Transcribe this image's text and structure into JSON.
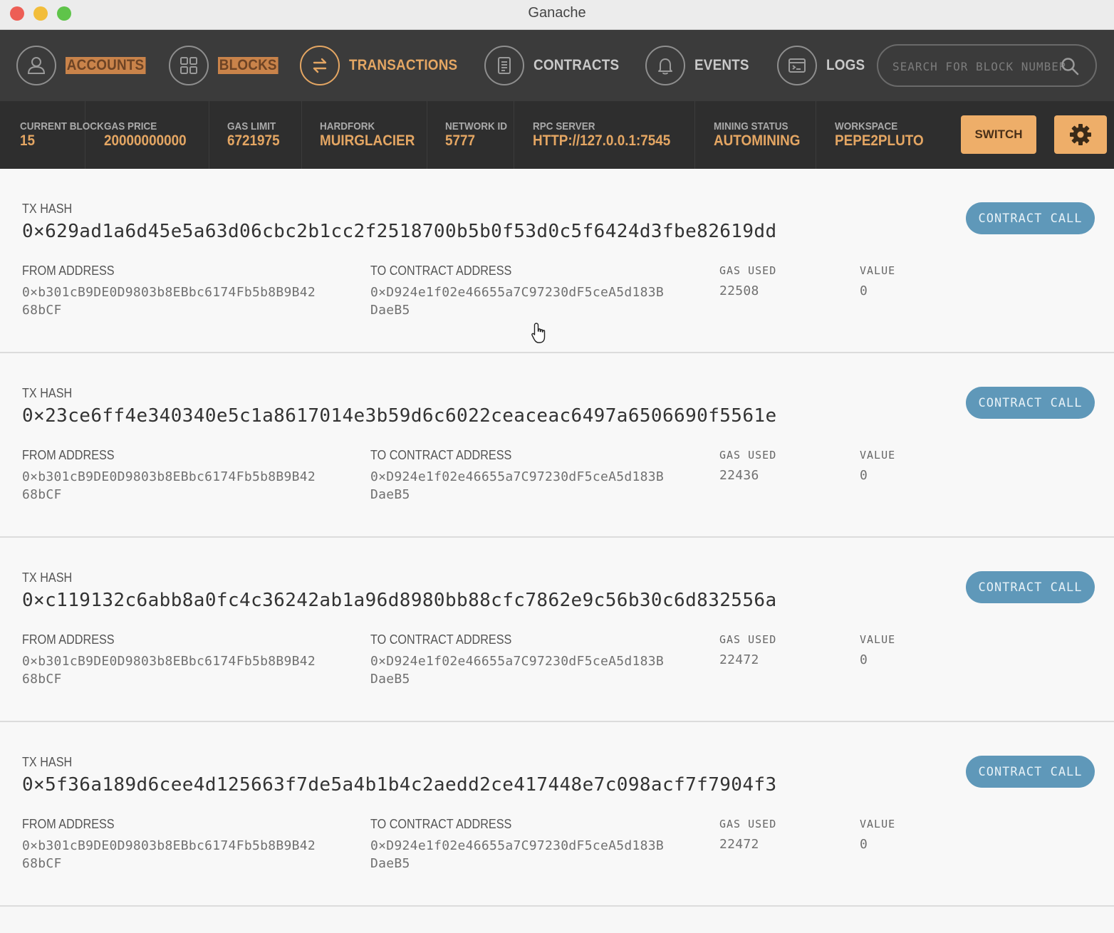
{
  "window": {
    "title": "Ganache"
  },
  "nav": {
    "items": [
      {
        "label": "ACCOUNTS",
        "icon": "person-icon"
      },
      {
        "label": "BLOCKS",
        "icon": "grid-icon"
      },
      {
        "label": "TRANSACTIONS",
        "icon": "arrows-exchange-icon"
      },
      {
        "label": "CONTRACTS",
        "icon": "document-icon"
      },
      {
        "label": "EVENTS",
        "icon": "bell-icon"
      },
      {
        "label": "LOGS",
        "icon": "terminal-icon"
      }
    ],
    "active": "TRANSACTIONS",
    "search_placeholder": "SEARCH FOR BLOCK NUMBERS OR TX HASHES"
  },
  "status": {
    "current_block": {
      "label": "CURRENT BLOCK",
      "value": "15"
    },
    "gas_price": {
      "label": "GAS PRICE",
      "value": "20000000000"
    },
    "gas_limit": {
      "label": "GAS LIMIT",
      "value": "6721975"
    },
    "hardfork": {
      "label": "HARDFORK",
      "value": "MUIRGLACIER"
    },
    "network_id": {
      "label": "NETWORK ID",
      "value": "5777"
    },
    "rpc_server": {
      "label": "RPC SERVER",
      "value": "HTTP://127.0.0.1:7545"
    },
    "mining_status": {
      "label": "MINING STATUS",
      "value": "AUTOMINING"
    },
    "workspace": {
      "label": "WORKSPACE",
      "value": "PEPE2PLUTO"
    },
    "switch_label": "SWITCH"
  },
  "labels": {
    "tx_hash": "TX HASH",
    "from_address": "FROM ADDRESS",
    "to_contract_address": "TO CONTRACT ADDRESS",
    "gas_used": "GAS USED",
    "value": "VALUE"
  },
  "transactions": [
    {
      "hash": "0×629ad1a6d45e5a63d06cbc2b1cc2f2518700b5b0f53d0c5f6424d3fbe82619dd",
      "from": "0×b301cB9DE0D9803b8EBbc6174Fb5b8B9B42\n68bCF",
      "to": "0×D924e1f02e46655a7C97230dF5ceA5d183B\nDaeB5",
      "gas_used": "22508",
      "value": "0",
      "type": "CONTRACT CALL"
    },
    {
      "hash": "0×23ce6ff4e340340e5c1a8617014e3b59d6c6022ceaceac6497a6506690f5561e",
      "from": "0×b301cB9DE0D9803b8EBbc6174Fb5b8B9B42\n68bCF",
      "to": "0×D924e1f02e46655a7C97230dF5ceA5d183B\nDaeB5",
      "gas_used": "22436",
      "value": "0",
      "type": "CONTRACT CALL"
    },
    {
      "hash": "0×c119132c6abb8a0fc4c36242ab1a96d8980bb88cfc7862e9c56b30c6d832556a",
      "from": "0×b301cB9DE0D9803b8EBbc6174Fb5b8B9B42\n68bCF",
      "to": "0×D924e1f02e46655a7C97230dF5ceA5d183B\nDaeB5",
      "gas_used": "22472",
      "value": "0",
      "type": "CONTRACT CALL"
    },
    {
      "hash": "0×5f36a189d6cee4d125663f7de5a4b1b4c2aedd2ce417448e7c098acf7f7904f3",
      "from": "0×b301cB9DE0D9803b8EBbc6174Fb5b8B9B42\n68bCF",
      "to": "0×D924e1f02e46655a7C97230dF5ceA5d183B\nDaeB5",
      "gas_used": "22472",
      "value": "0",
      "type": "CONTRACT CALL"
    }
  ],
  "colors": {
    "accent": "#e4a663",
    "nav_bg": "#3b3b3b",
    "status_bg": "#2e2e2e",
    "badge": "#5f98b9"
  }
}
